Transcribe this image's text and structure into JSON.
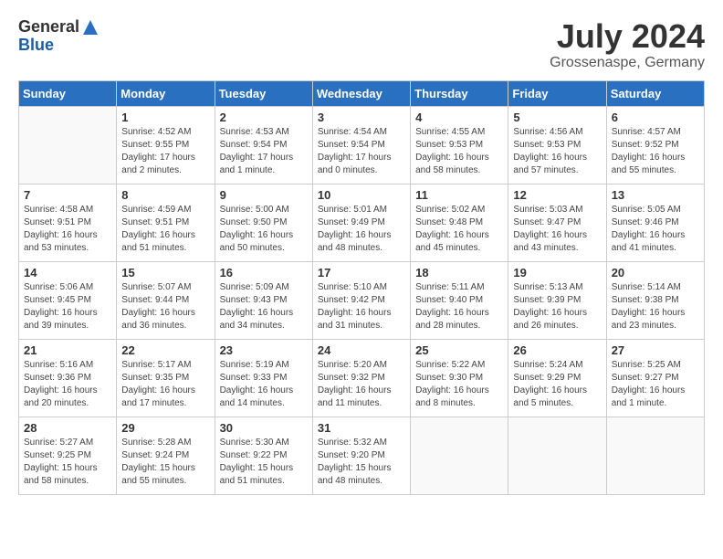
{
  "header": {
    "logo_line1": "General",
    "logo_line2": "Blue",
    "month_year": "July 2024",
    "location": "Grossenaspe, Germany"
  },
  "weekdays": [
    "Sunday",
    "Monday",
    "Tuesday",
    "Wednesday",
    "Thursday",
    "Friday",
    "Saturday"
  ],
  "weeks": [
    [
      {
        "day": "",
        "info": ""
      },
      {
        "day": "1",
        "info": "Sunrise: 4:52 AM\nSunset: 9:55 PM\nDaylight: 17 hours\nand 2 minutes."
      },
      {
        "day": "2",
        "info": "Sunrise: 4:53 AM\nSunset: 9:54 PM\nDaylight: 17 hours\nand 1 minute."
      },
      {
        "day": "3",
        "info": "Sunrise: 4:54 AM\nSunset: 9:54 PM\nDaylight: 17 hours\nand 0 minutes."
      },
      {
        "day": "4",
        "info": "Sunrise: 4:55 AM\nSunset: 9:53 PM\nDaylight: 16 hours\nand 58 minutes."
      },
      {
        "day": "5",
        "info": "Sunrise: 4:56 AM\nSunset: 9:53 PM\nDaylight: 16 hours\nand 57 minutes."
      },
      {
        "day": "6",
        "info": "Sunrise: 4:57 AM\nSunset: 9:52 PM\nDaylight: 16 hours\nand 55 minutes."
      }
    ],
    [
      {
        "day": "7",
        "info": "Sunrise: 4:58 AM\nSunset: 9:51 PM\nDaylight: 16 hours\nand 53 minutes."
      },
      {
        "day": "8",
        "info": "Sunrise: 4:59 AM\nSunset: 9:51 PM\nDaylight: 16 hours\nand 51 minutes."
      },
      {
        "day": "9",
        "info": "Sunrise: 5:00 AM\nSunset: 9:50 PM\nDaylight: 16 hours\nand 50 minutes."
      },
      {
        "day": "10",
        "info": "Sunrise: 5:01 AM\nSunset: 9:49 PM\nDaylight: 16 hours\nand 48 minutes."
      },
      {
        "day": "11",
        "info": "Sunrise: 5:02 AM\nSunset: 9:48 PM\nDaylight: 16 hours\nand 45 minutes."
      },
      {
        "day": "12",
        "info": "Sunrise: 5:03 AM\nSunset: 9:47 PM\nDaylight: 16 hours\nand 43 minutes."
      },
      {
        "day": "13",
        "info": "Sunrise: 5:05 AM\nSunset: 9:46 PM\nDaylight: 16 hours\nand 41 minutes."
      }
    ],
    [
      {
        "day": "14",
        "info": "Sunrise: 5:06 AM\nSunset: 9:45 PM\nDaylight: 16 hours\nand 39 minutes."
      },
      {
        "day": "15",
        "info": "Sunrise: 5:07 AM\nSunset: 9:44 PM\nDaylight: 16 hours\nand 36 minutes."
      },
      {
        "day": "16",
        "info": "Sunrise: 5:09 AM\nSunset: 9:43 PM\nDaylight: 16 hours\nand 34 minutes."
      },
      {
        "day": "17",
        "info": "Sunrise: 5:10 AM\nSunset: 9:42 PM\nDaylight: 16 hours\nand 31 minutes."
      },
      {
        "day": "18",
        "info": "Sunrise: 5:11 AM\nSunset: 9:40 PM\nDaylight: 16 hours\nand 28 minutes."
      },
      {
        "day": "19",
        "info": "Sunrise: 5:13 AM\nSunset: 9:39 PM\nDaylight: 16 hours\nand 26 minutes."
      },
      {
        "day": "20",
        "info": "Sunrise: 5:14 AM\nSunset: 9:38 PM\nDaylight: 16 hours\nand 23 minutes."
      }
    ],
    [
      {
        "day": "21",
        "info": "Sunrise: 5:16 AM\nSunset: 9:36 PM\nDaylight: 16 hours\nand 20 minutes."
      },
      {
        "day": "22",
        "info": "Sunrise: 5:17 AM\nSunset: 9:35 PM\nDaylight: 16 hours\nand 17 minutes."
      },
      {
        "day": "23",
        "info": "Sunrise: 5:19 AM\nSunset: 9:33 PM\nDaylight: 16 hours\nand 14 minutes."
      },
      {
        "day": "24",
        "info": "Sunrise: 5:20 AM\nSunset: 9:32 PM\nDaylight: 16 hours\nand 11 minutes."
      },
      {
        "day": "25",
        "info": "Sunrise: 5:22 AM\nSunset: 9:30 PM\nDaylight: 16 hours\nand 8 minutes."
      },
      {
        "day": "26",
        "info": "Sunrise: 5:24 AM\nSunset: 9:29 PM\nDaylight: 16 hours\nand 5 minutes."
      },
      {
        "day": "27",
        "info": "Sunrise: 5:25 AM\nSunset: 9:27 PM\nDaylight: 16 hours\nand 1 minute."
      }
    ],
    [
      {
        "day": "28",
        "info": "Sunrise: 5:27 AM\nSunset: 9:25 PM\nDaylight: 15 hours\nand 58 minutes."
      },
      {
        "day": "29",
        "info": "Sunrise: 5:28 AM\nSunset: 9:24 PM\nDaylight: 15 hours\nand 55 minutes."
      },
      {
        "day": "30",
        "info": "Sunrise: 5:30 AM\nSunset: 9:22 PM\nDaylight: 15 hours\nand 51 minutes."
      },
      {
        "day": "31",
        "info": "Sunrise: 5:32 AM\nSunset: 9:20 PM\nDaylight: 15 hours\nand 48 minutes."
      },
      {
        "day": "",
        "info": ""
      },
      {
        "day": "",
        "info": ""
      },
      {
        "day": "",
        "info": ""
      }
    ]
  ]
}
